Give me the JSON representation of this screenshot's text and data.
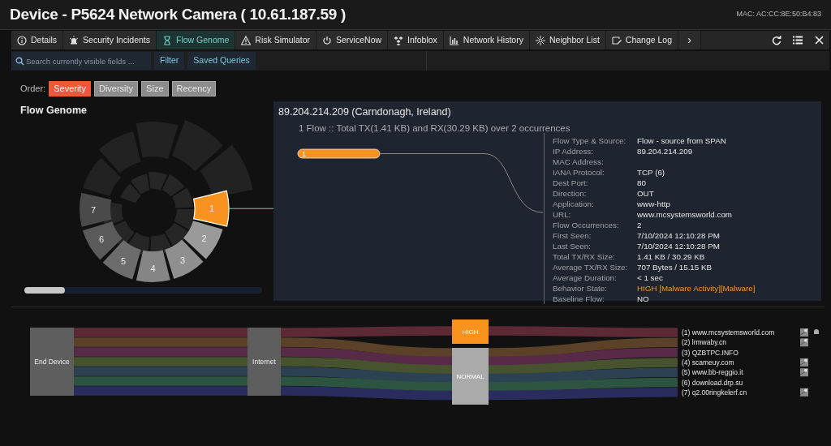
{
  "window": {
    "title": "Device - P5624 Network Camera ( 10.61.187.59 )",
    "mac": "MAC: AC:CC:8E:50:B4:83"
  },
  "tabs": [
    {
      "label": "Details",
      "selected": false
    },
    {
      "label": "Security Incidents",
      "selected": false
    },
    {
      "label": "Flow Genome",
      "selected": true
    },
    {
      "label": "Risk Simulator",
      "selected": false
    },
    {
      "label": "ServiceNow",
      "selected": false
    },
    {
      "label": "Infoblox",
      "selected": false
    },
    {
      "label": "Network History",
      "selected": false
    },
    {
      "label": "Neighbor List",
      "selected": false
    },
    {
      "label": "Change Log",
      "selected": false
    }
  ],
  "tab_more": "›",
  "search": {
    "placeholder": "Search currently visible fields ...",
    "buttons": [
      "Filter",
      "Saved Queries"
    ]
  },
  "order": {
    "label": "Order:",
    "options": [
      {
        "label": "Severity",
        "selected": true
      },
      {
        "label": "Diversity",
        "selected": false
      },
      {
        "label": "Size",
        "selected": false
      },
      {
        "label": "Recency",
        "selected": false
      }
    ]
  },
  "genome": {
    "title": "Flow Genome",
    "segments": [
      {
        "label": "1",
        "selected": true,
        "color": "#f7931e"
      },
      {
        "label": "2",
        "selected": false,
        "color": "#9a9a9a"
      },
      {
        "label": "3",
        "selected": false,
        "color": "#8f8f8f"
      },
      {
        "label": "4",
        "selected": false,
        "color": "#858585"
      },
      {
        "label": "5",
        "selected": false,
        "color": "#6c6c6c"
      },
      {
        "label": "6",
        "selected": false,
        "color": "#5a5a5a"
      },
      {
        "label": "7",
        "selected": false,
        "color": "#4a4a4a"
      }
    ]
  },
  "detail": {
    "title": "89.204.214.209 (Carndonagh, Ireland)",
    "summary": "1 Flow :: Total TX(1.41 KB) and RX(30.29 KB) over 2 occurrences",
    "flows": [
      {
        "label": "1",
        "selected": true
      }
    ],
    "fields": [
      {
        "label": "Flow Type & Source:",
        "value": "Flow - source from SPAN",
        "highlight": false
      },
      {
        "label": "IP Address:",
        "value": "89.204.214.209",
        "highlight": false
      },
      {
        "label": "MAC Address:"
      },
      {
        "label": "IANA Protocol:",
        "value": "TCP (6)",
        "highlight": false
      },
      {
        "label": "Dest Port:",
        "value": "80",
        "highlight": false
      },
      {
        "label": "Direction:",
        "value": "OUT",
        "highlight": false
      },
      {
        "label": "Application:",
        "value": "www-http",
        "highlight": false
      },
      {
        "label": "URL:",
        "value": "www.mcsystemsworld.com",
        "highlight": false
      },
      {
        "label": "Flow Occurrences:",
        "value": "2",
        "highlight": false
      },
      {
        "label": "First Seen:",
        "value": "7/10/2024 12:10:28 PM",
        "highlight": false
      },
      {
        "label": "Last Seen:",
        "value": "7/10/2024 12:10:28 PM",
        "highlight": false
      },
      {
        "label": "Total TX/RX Size:",
        "value": "1.41 KB / 30.29 KB",
        "highlight": false
      },
      {
        "label": "Average TX/RX Size:",
        "value": "707 Bytes / 15.15 KB",
        "highlight": false
      },
      {
        "label": "Average Duration:",
        "value": "< 1 sec",
        "highlight": false
      },
      {
        "label": "Behavior State:",
        "value": "HIGH [Malware Activity][Malware]",
        "highlight": true
      },
      {
        "label": "Baseline Flow:",
        "value": "NO",
        "highlight": false
      }
    ]
  },
  "sankey": {
    "stages": [
      {
        "label": "End Device"
      },
      {
        "label": "Internet"
      }
    ],
    "severity_nodes": [
      {
        "label": "HIGH",
        "kind": "high",
        "destinations": [
          {
            "label": "(1) www.mcsystemsworld.com",
            "color": "#5c2a34",
            "map": true,
            "alert": true
          }
        ]
      },
      {
        "label": "NORMAL",
        "kind": "normal",
        "destinations": [
          {
            "label": "(2) lrmwaby.cn",
            "color": "#5a4128",
            "map": true,
            "alert": false
          },
          {
            "label": "(3) QZBTPC.INFO",
            "color": "#572a48",
            "map": false,
            "alert": false
          },
          {
            "label": "(4) scameuy.com",
            "color": "#46532e",
            "map": true,
            "alert": false
          },
          {
            "label": "(5) www.bb-reggio.it",
            "color": "#2c4152",
            "map": true,
            "alert": false
          },
          {
            "label": "(6) download.drp.su",
            "color": "#2d5341",
            "map": false,
            "alert": false
          },
          {
            "label": "(7) q2.00ringkelerf.cn",
            "color": "#2b2c5e",
            "map": true,
            "alert": false
          }
        ]
      }
    ]
  }
}
